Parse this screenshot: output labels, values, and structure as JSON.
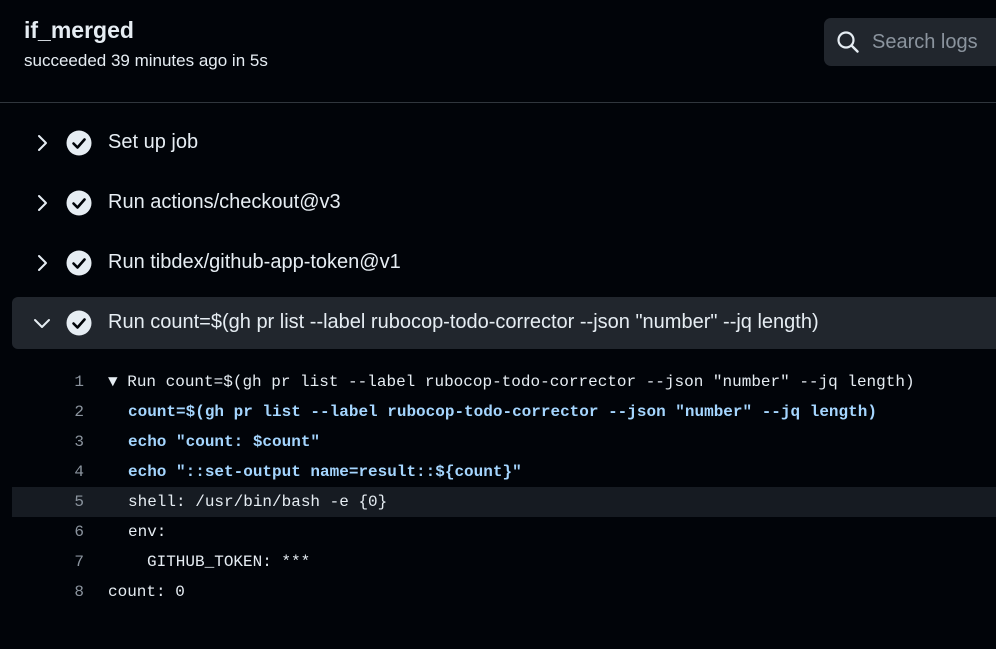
{
  "job": {
    "title": "if_merged",
    "status": "succeeded 39 minutes ago in 5s"
  },
  "search": {
    "placeholder": "Search logs"
  },
  "steps": [
    {
      "label": "Set up job",
      "expanded": false,
      "status": "success"
    },
    {
      "label": "Run actions/checkout@v3",
      "expanded": false,
      "status": "success"
    },
    {
      "label": "Run tibdex/github-app-token@v1",
      "expanded": false,
      "status": "success"
    },
    {
      "label": "Run count=$(gh pr list --label rubocop-todo-corrector --json \"number\" --jq length)",
      "expanded": true,
      "status": "success"
    }
  ],
  "log_lines": [
    {
      "num": "1",
      "marker": "▼",
      "text": "Run count=$(gh pr list --label rubocop-todo-corrector --json \"number\" --jq length)"
    },
    {
      "num": "2",
      "text": "count=$(gh pr list --label rubocop-todo-corrector --json \"number\" --jq length)"
    },
    {
      "num": "3",
      "text": "echo \"count: $count\""
    },
    {
      "num": "4",
      "text": "echo \"::set-output name=result::${count}\""
    },
    {
      "num": "5",
      "text": "shell: /usr/bin/bash -e {0}"
    },
    {
      "num": "6",
      "text": "env:"
    },
    {
      "num": "7",
      "text": "GITHUB_TOKEN: ***"
    },
    {
      "num": "8",
      "text": "count: 0"
    }
  ],
  "colors": {
    "background": "#010409",
    "expanded_step_bg": "#21262d",
    "command_text": "#a5d6ff",
    "muted_text": "#8b949e"
  },
  "icons": {
    "collapsed": "chevron-right-icon",
    "expanded": "chevron-down-icon",
    "status": "check-circle-icon",
    "search": "search-icon"
  }
}
